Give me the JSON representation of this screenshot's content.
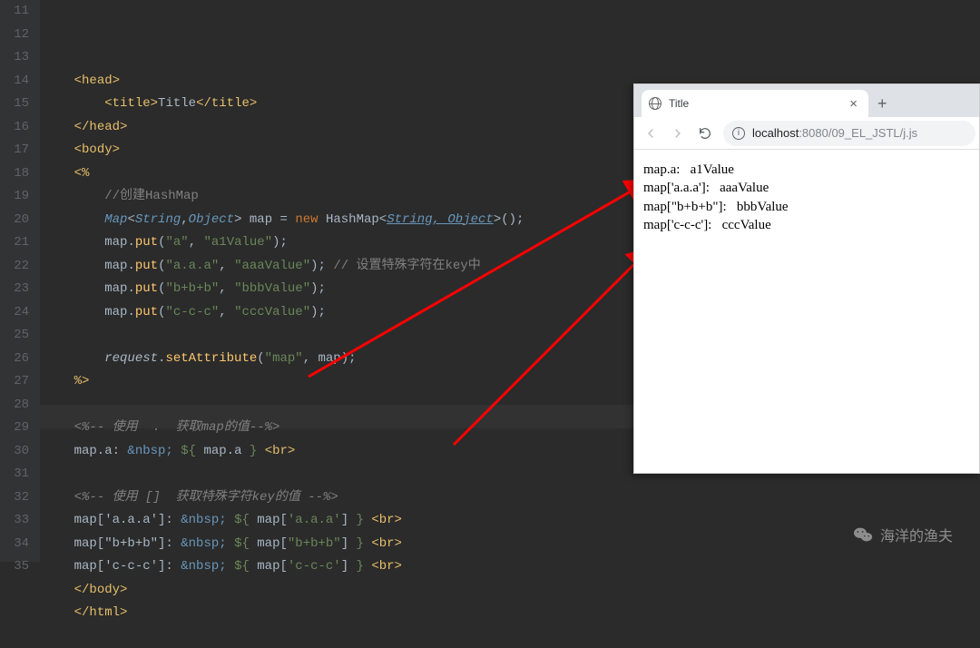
{
  "gutter": {
    "start": 11,
    "end": 35
  },
  "code_lines": {
    "11": {
      "indent": "    ",
      "html": "<span class='tag'>&lt;<span class='tagname'>head</span>&gt;</span>"
    },
    "12": {
      "indent": "        ",
      "html": "<span class='tag'>&lt;<span class='tagname'>title</span>&gt;</span>Title<span class='tag'>&lt;/<span class='tagname'>title</span>&gt;</span>"
    },
    "13": {
      "indent": "    ",
      "html": "<span class='tag'>&lt;/<span class='tagname'>head</span>&gt;</span>"
    },
    "14": {
      "indent": "    ",
      "html": "<span class='tag'>&lt;<span class='tagname'>body</span>&gt;</span>"
    },
    "15": {
      "indent": "    ",
      "html": "<span class='tag'>&lt;%</span>"
    },
    "16": {
      "indent": "        ",
      "html": "<span class='comment'>//创建HashMap</span>"
    },
    "17": {
      "indent": "        ",
      "html": "<span class='type italic'>Map</span><span class='op'>&lt;</span><span class='type italic'>String</span><span class='op'>,</span><span class='type italic'>Object</span><span class='op'>&gt; </span><span class='var'>map</span> <span class='op'>=</span> <span class='kw'>new</span> <span class='var'>HashMap</span><span class='op'>&lt;</span><span class='type italic' style='text-decoration:underline'>String, Object</span><span class='op'>&gt;();</span>"
    },
    "18": {
      "indent": "        ",
      "html": "<span class='var'>map</span>.<span class='method'>put</span>(<span class='string'>\"a\"</span>, <span class='string'>\"a1Value\"</span>);"
    },
    "19": {
      "indent": "        ",
      "html": "<span class='var'>map</span>.<span class='method'>put</span>(<span class='string'>\"a.a.a\"</span>, <span class='string'>\"aaaValue\"</span>); <span class='comment'>// 设置特殊字符在key中</span>"
    },
    "20": {
      "indent": "        ",
      "html": "<span class='var'>map</span>.<span class='method'>put</span>(<span class='string'>\"b+b+b\"</span>, <span class='string'>\"bbbValue\"</span>);"
    },
    "21": {
      "indent": "        ",
      "html": "<span class='var'>map</span>.<span class='method'>put</span>(<span class='string'>\"c-c-c\"</span>, <span class='string'>\"cccValue\"</span>);"
    },
    "22": {
      "indent": "",
      "html": ""
    },
    "23": {
      "indent": "        ",
      "html": "<span class='var italic'>request</span>.<span class='method'>setAttribute</span>(<span class='string'>\"map\"</span>, <span class='var'>map</span>);"
    },
    "24": {
      "indent": "    ",
      "html": "<span class='tag'>%&gt;</span>"
    },
    "25": {
      "indent": "",
      "html": ""
    },
    "26": {
      "indent": "    ",
      "html": "<span class='comment italic'>&lt;%-- 使用  .  获取map的值--%&gt;</span>"
    },
    "27": {
      "indent": "    ",
      "html": "map.a: <span class='ent'>&amp;nbsp;</span> <span class='elop'>${</span><span class='elexpr'> map.a </span><span class='elop'>}</span> <span class='tag'>&lt;<span class='tagname'>br</span>&gt;</span>"
    },
    "28": {
      "indent": "",
      "html": ""
    },
    "29": {
      "indent": "    ",
      "html": "<span class='comment italic'>&lt;%-- 使用 []  获取特殊字符key的值 --%&gt;</span>"
    },
    "30": {
      "indent": "    ",
      "html": "map['a.a.a']: <span class='ent'>&amp;nbsp;</span> <span class='elop'>${</span><span class='elexpr'> map[</span><span class='string'>'a.a.a'</span><span class='elexpr'>] </span><span class='elop'>}</span> <span class='tag'>&lt;<span class='tagname'>br</span>&gt;</span>"
    },
    "31": {
      "indent": "    ",
      "html": "map[\"b+b+b\"]: <span class='ent'>&amp;nbsp;</span> <span class='elop'>${</span><span class='elexpr'> map[</span><span class='string'>\"b+b+b\"</span><span class='elexpr'>] </span><span class='elop'>}</span> <span class='tag'>&lt;<span class='tagname'>br</span>&gt;</span>"
    },
    "32": {
      "indent": "    ",
      "html": "map['c-c-c']: <span class='ent'>&amp;nbsp;</span> <span class='elop'>${</span><span class='elexpr'> map[</span><span class='string'>'c-c-c'</span><span class='elexpr'>] </span><span class='elop'>}</span> <span class='tag'>&lt;<span class='tagname'>br</span>&gt;</span>"
    },
    "33": {
      "indent": "    ",
      "html": "<span class='tag'>&lt;/<span class='tagname'>body</span>&gt;</span>"
    },
    "34": {
      "indent": "    ",
      "html": "<span class='tag'>&lt;/<span class='tagname'>html</span>&gt;</span>"
    },
    "35": {
      "indent": "",
      "html": ""
    }
  },
  "browser": {
    "tab_title": "Title",
    "url_host": "localhost",
    "url_path": ":8080/09_EL_JSTL/j.js",
    "output": [
      "map.a:   a1Value",
      "map['a.a.a']:   aaaValue",
      "map[\"b+b+b\"]:   bbbValue",
      "map['c-c-c']:   cccValue"
    ]
  },
  "watermark": {
    "text": "海洋的渔夫"
  }
}
